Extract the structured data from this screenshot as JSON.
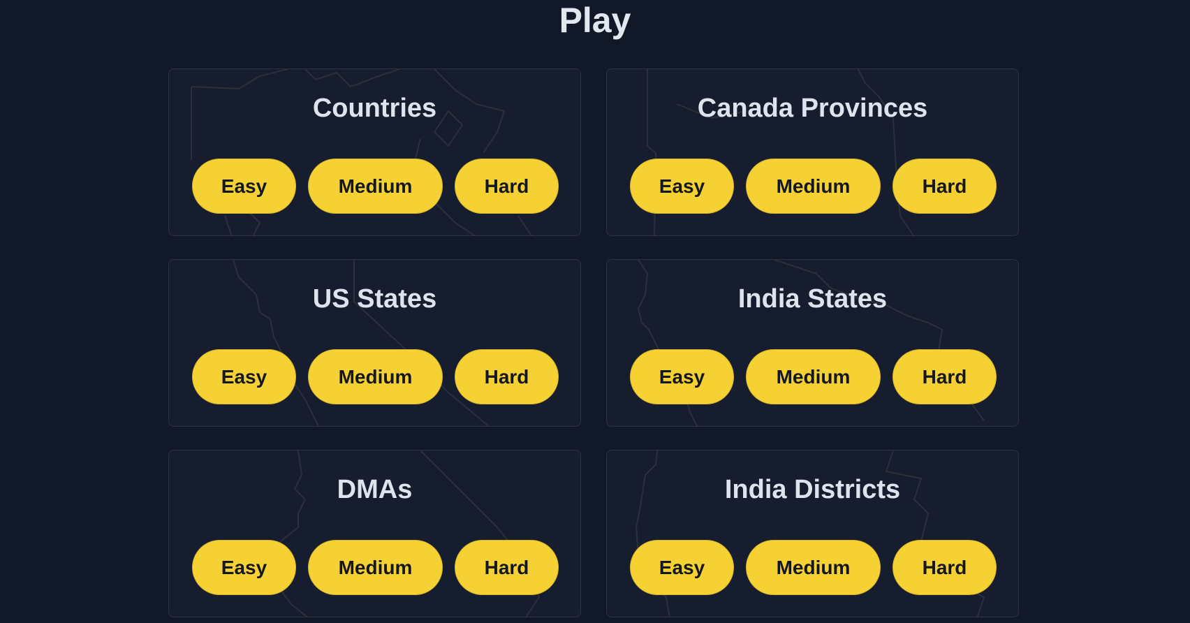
{
  "page": {
    "title": "Play"
  },
  "colors": {
    "background": "#111827",
    "card": "#151d2e",
    "button": "#f5d133",
    "button_text": "#14171f",
    "title_text": "#e2e8f0"
  },
  "cards": [
    {
      "title": "Countries",
      "map_icon": "world-map-outline",
      "buttons": [
        "Easy",
        "Medium",
        "Hard"
      ]
    },
    {
      "title": "Canada Provinces",
      "map_icon": "canada-map-outline",
      "buttons": [
        "Easy",
        "Medium",
        "Hard"
      ]
    },
    {
      "title": "US States",
      "map_icon": "us-map-outline",
      "buttons": [
        "Easy",
        "Medium",
        "Hard"
      ]
    },
    {
      "title": "India States",
      "map_icon": "india-map-outline",
      "buttons": [
        "Easy",
        "Medium",
        "Hard"
      ]
    },
    {
      "title": "DMAs",
      "map_icon": "dma-map-outline",
      "buttons": [
        "Easy",
        "Medium",
        "Hard"
      ]
    },
    {
      "title": "India Districts",
      "map_icon": "india-districts-map-outline",
      "buttons": [
        "Easy",
        "Medium",
        "Hard"
      ]
    }
  ]
}
